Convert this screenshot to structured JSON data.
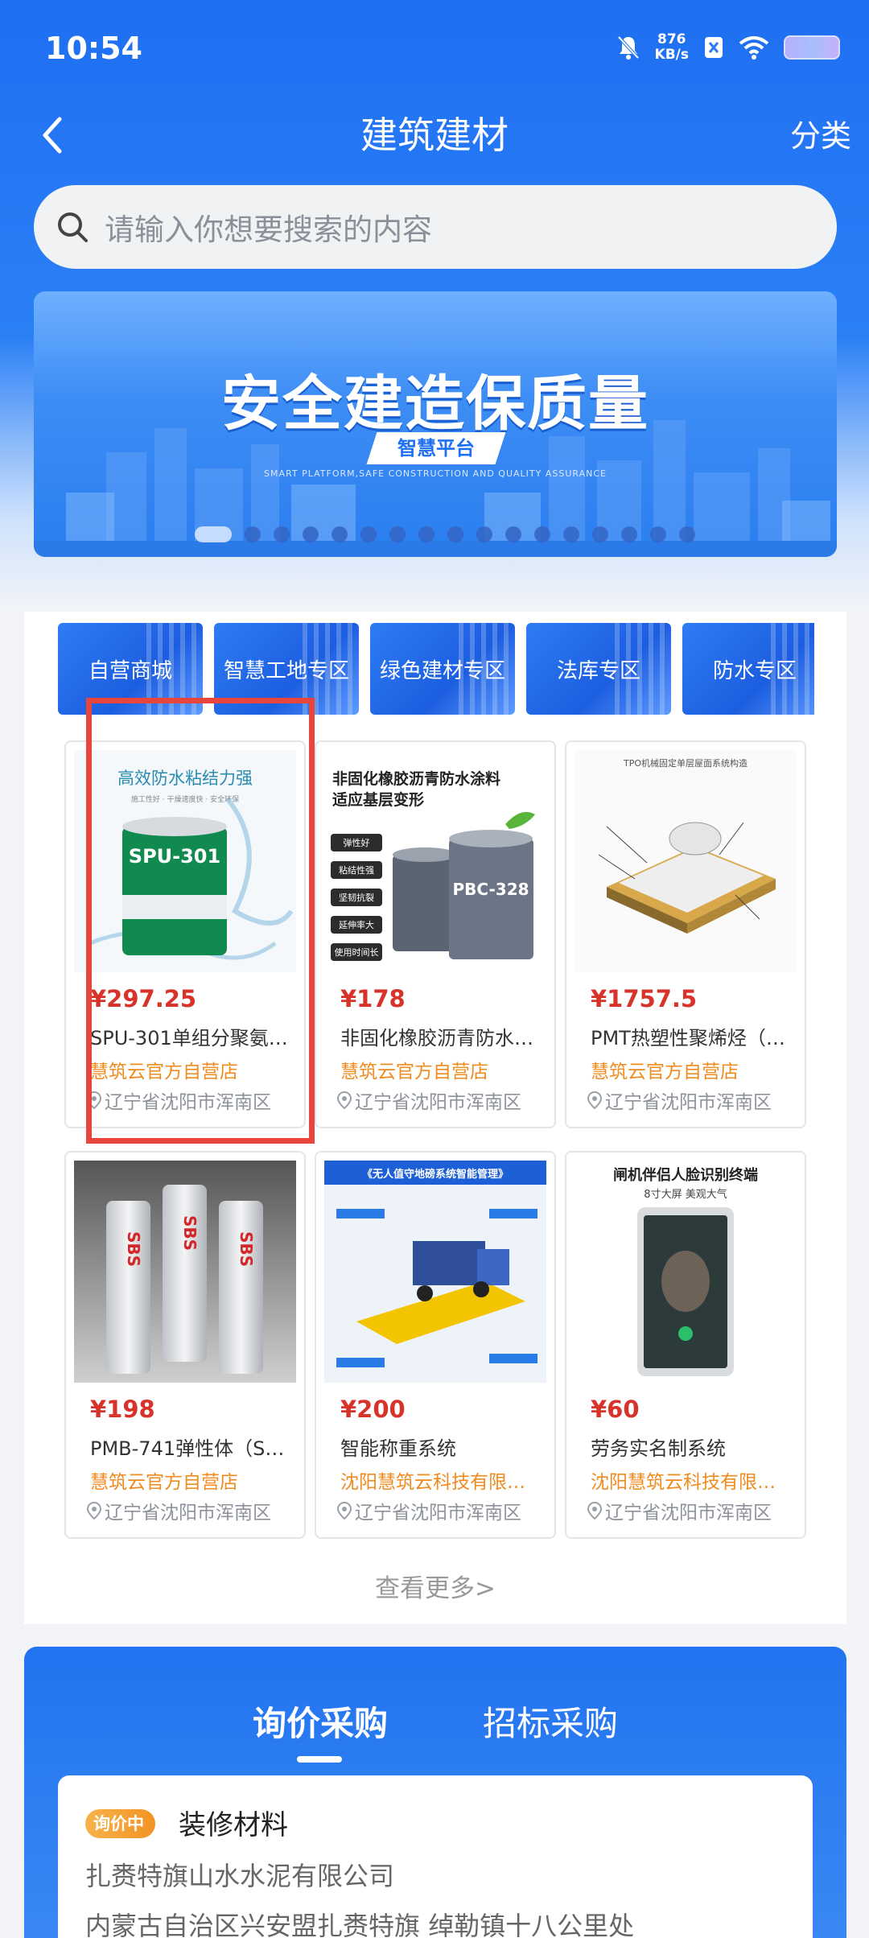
{
  "status_bar": {
    "time": "10:54",
    "net_speed_value": "876",
    "net_speed_unit": "KB/s"
  },
  "header": {
    "title": "建筑建材",
    "right_action": "分类"
  },
  "search": {
    "placeholder": "请输入你想要搜索的内容"
  },
  "banner": {
    "headline": "安全建造保质量",
    "subtitle": "智慧平台",
    "english": "SMART PLATFORM,SAFE CONSTRUCTION AND QUALITY ASSURANCE",
    "active_slide": 1,
    "slide_count": 17
  },
  "categories": [
    "自营商城",
    "智慧工地专区",
    "绿色建材专区",
    "法库专区",
    "防水专区"
  ],
  "products": [
    {
      "price": "¥297.25",
      "name": "SPU-301单组分聚氨…",
      "shop": "慧筑云官方自营店",
      "location": "辽宁省沈阳市浑南区",
      "image": "waterproof-adhesive-bucket"
    },
    {
      "price": "¥178",
      "name": "非固化橡胶沥青防水…",
      "shop": "慧筑云官方自营店",
      "location": "辽宁省沈阳市浑南区",
      "image": "asphalt-coating-buckets"
    },
    {
      "price": "¥1757.5",
      "name": "PMT热塑性聚烯烃（T…",
      "shop": "慧筑云官方自营店",
      "location": "辽宁省沈阳市浑南区",
      "image": "tpo-membrane-diagram"
    },
    {
      "price": "¥198",
      "name": "PMB-741弹性体（SB…",
      "shop": "慧筑云官方自营店",
      "location": "辽宁省沈阳市浑南区",
      "image": "sbs-membrane-rolls"
    },
    {
      "price": "¥200",
      "name": "智能称重系统",
      "shop": "沈阳慧筑云科技有限…",
      "location": "辽宁省沈阳市浑南区",
      "image": "truck-scale-system"
    },
    {
      "price": "¥60",
      "name": "劳务实名制系统",
      "shop": "沈阳慧筑云科技有限…",
      "location": "辽宁省沈阳市浑南区",
      "image": "face-recognition-terminal"
    }
  ],
  "product_image_text": {
    "p1_headline": "高效防水粘结力强",
    "p1_sub": "施工性好 · 干燥速度快 · 安全环保",
    "p1_brand": "SPU-301",
    "p2_line1": "非固化橡胶沥青防水涂料",
    "p2_line2": "适应基层变形",
    "p2_tags": [
      "弹性好",
      "粘结性强",
      "坚韧抗裂",
      "延伸率大",
      "使用时间长"
    ],
    "p2_brand": "PBC-328",
    "p3_title": "TPO机械固定单层屋面系统构造",
    "p4_brand": "SBS",
    "p5_title": "《无人值守地磅系统智能管理》",
    "p6_title": "闸机伴侣人脸识别终端",
    "p6_sub": "8寸大屏 美观大气"
  },
  "more_link": "查看更多>",
  "purchase": {
    "tabs": [
      "询价采购",
      "招标采购"
    ],
    "active_tab": 0,
    "item": {
      "badge": "询价中",
      "title": "装修材料",
      "company": "扎赉特旗山水水泥有限公司",
      "address": "内蒙古自治区兴安盟扎赉特旗 绰勒镇十八公里处"
    }
  },
  "colors": {
    "primary": "#1f6ff2",
    "price": "#d7332b",
    "shop": "#f08b1f",
    "highlight": "#e8453c"
  }
}
